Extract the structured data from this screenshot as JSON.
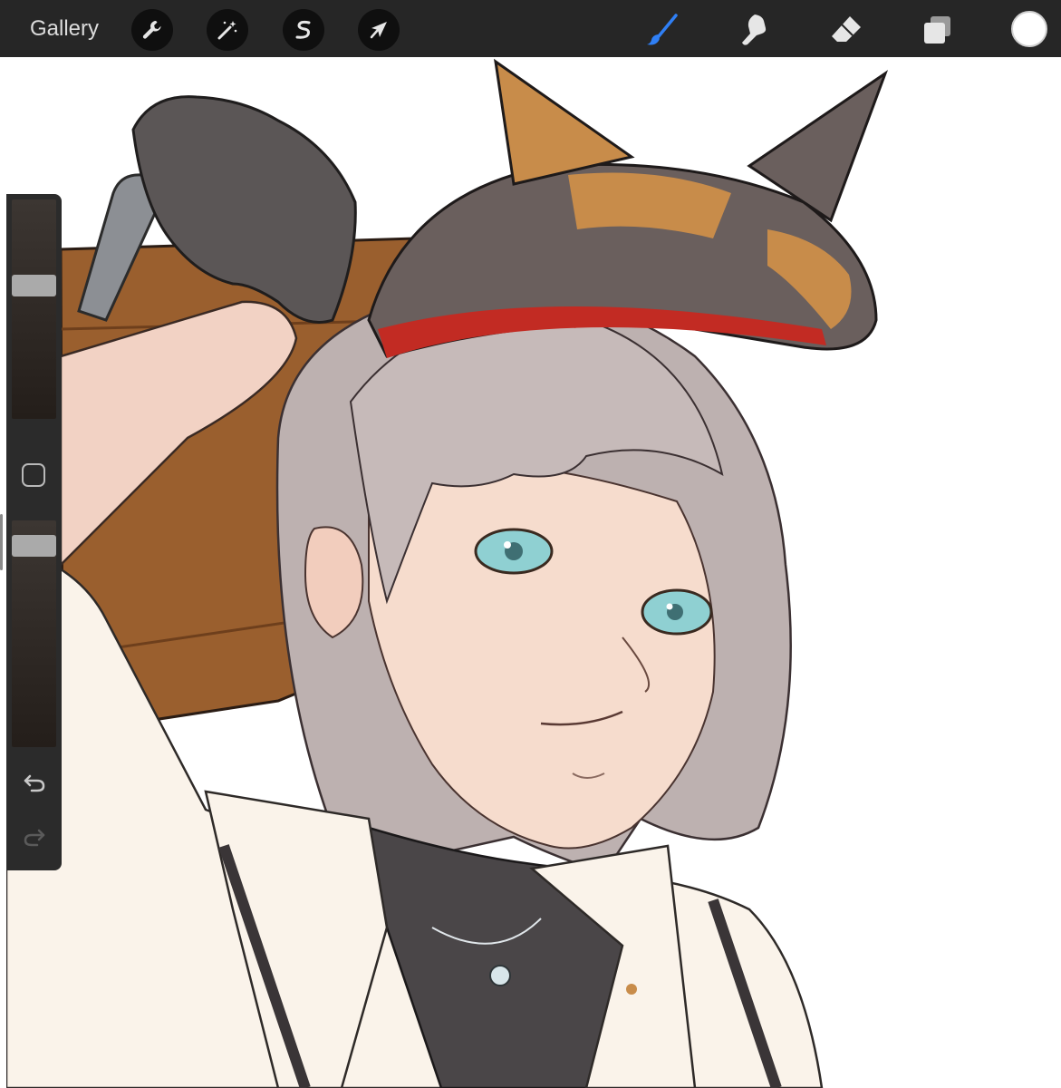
{
  "toolbar": {
    "gallery_label": "Gallery",
    "left_tools": [
      "wrench-icon",
      "magic-wand-icon",
      "selection-s-icon",
      "arrow-cursor-icon"
    ],
    "right_tools": [
      "brush-icon",
      "smudge-icon",
      "eraser-icon",
      "layers-icon"
    ],
    "active_tool": "brush-icon",
    "active_tool_color": "#2f7ff5",
    "current_color": "#ffffff"
  },
  "sidebar": {
    "brush_size_level": 0.62,
    "opacity_level": 0.93,
    "icons": [
      "modify-square-icon",
      "undo-icon",
      "redo-icon"
    ]
  },
  "colors": {
    "toolbar_bg": "#262626",
    "hair": "#bdb1b0",
    "eyes": "#8fd0d2",
    "skin": "#f6dccd",
    "hat": "#6a5f5d",
    "hat_accent": "#c88c4a",
    "hat_band": "#c22b23",
    "case": "#9a5f2e",
    "glove": "#5b5656",
    "shirt": "#faf3ea",
    "undershirt": "#4a4648"
  }
}
